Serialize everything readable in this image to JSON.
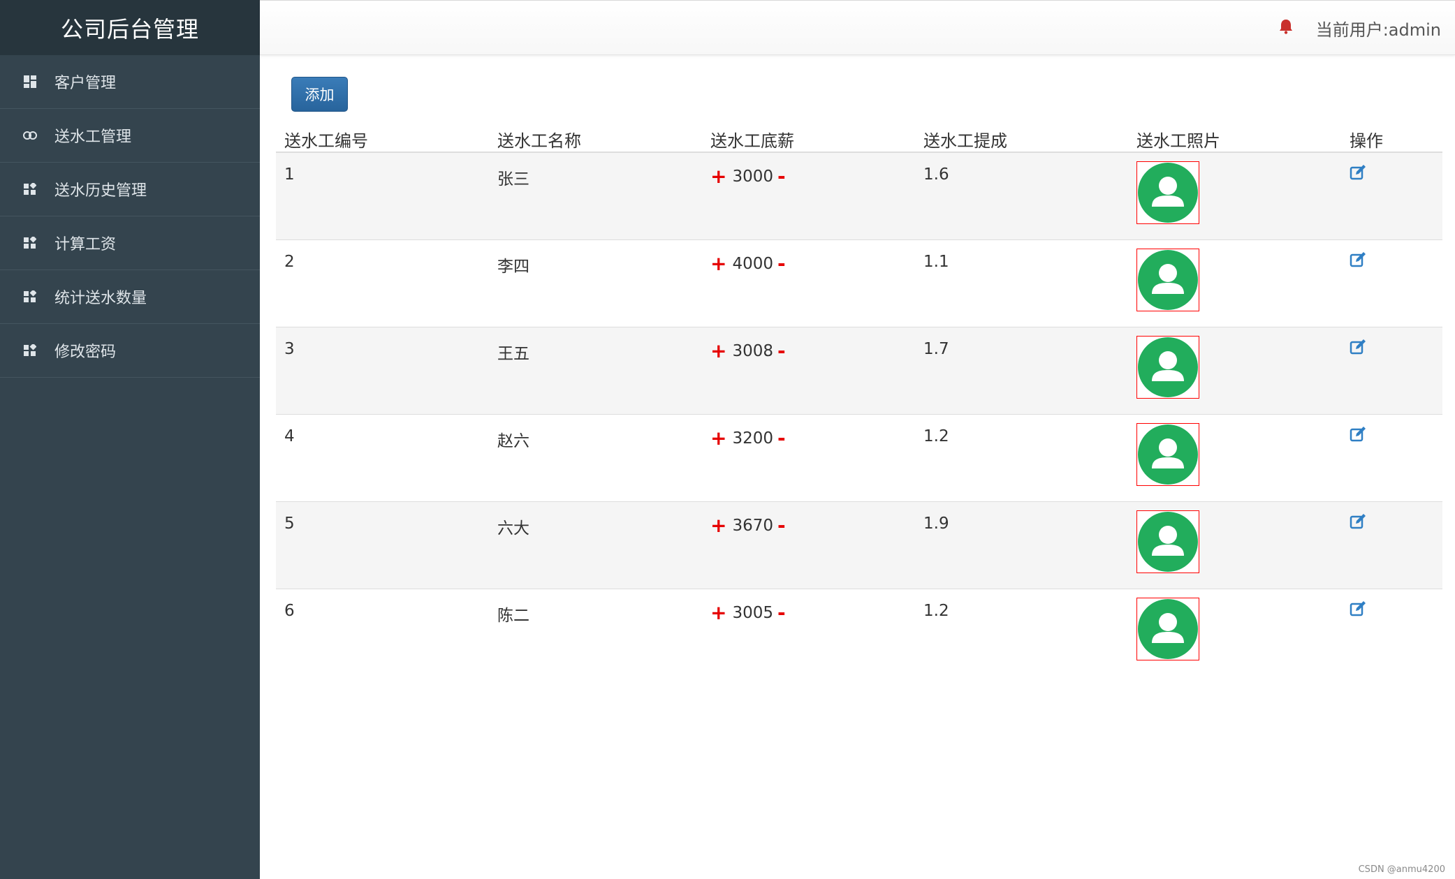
{
  "brand": {
    "title": "公司后台管理"
  },
  "sidebar": {
    "items": [
      {
        "label": "客户管理",
        "icon": "dashboard-icon"
      },
      {
        "label": "送水工管理",
        "icon": "link-icon"
      },
      {
        "label": "送水历史管理",
        "icon": "widgets-icon"
      },
      {
        "label": "计算工资",
        "icon": "widgets-icon"
      },
      {
        "label": "统计送水数量",
        "icon": "widgets-icon"
      },
      {
        "label": "修改密码",
        "icon": "widgets-icon"
      }
    ]
  },
  "header": {
    "current_user": "当前用户:admin",
    "icon": "bell-icon"
  },
  "toolbar": {
    "add_label": "添加"
  },
  "table": {
    "headers": [
      "送水工编号",
      "送水工名称",
      "送水工底薪",
      "送水工提成",
      "送水工照片",
      "操作"
    ],
    "rows": [
      {
        "id": "1",
        "name": "张三",
        "salary": "3000",
        "commission": "1.6"
      },
      {
        "id": "2",
        "name": "李四",
        "salary": "4000",
        "commission": "1.1"
      },
      {
        "id": "3",
        "name": "王五",
        "salary": "3008",
        "commission": "1.7"
      },
      {
        "id": "4",
        "name": "赵六",
        "salary": "3200",
        "commission": "1.2"
      },
      {
        "id": "5",
        "name": "六大",
        "salary": "3670",
        "commission": "1.9"
      },
      {
        "id": "6",
        "name": "陈二",
        "salary": "3005",
        "commission": "1.2"
      }
    ]
  },
  "colors": {
    "sidebar_bg": "#34444e",
    "brand_bg": "#27353d",
    "accent_red": "#e60000",
    "avatar_green": "#22ad5c",
    "edit_blue": "#2f7fc4",
    "button_blue": "#2f6fa8"
  },
  "watermark": "CSDN @anmu4200"
}
